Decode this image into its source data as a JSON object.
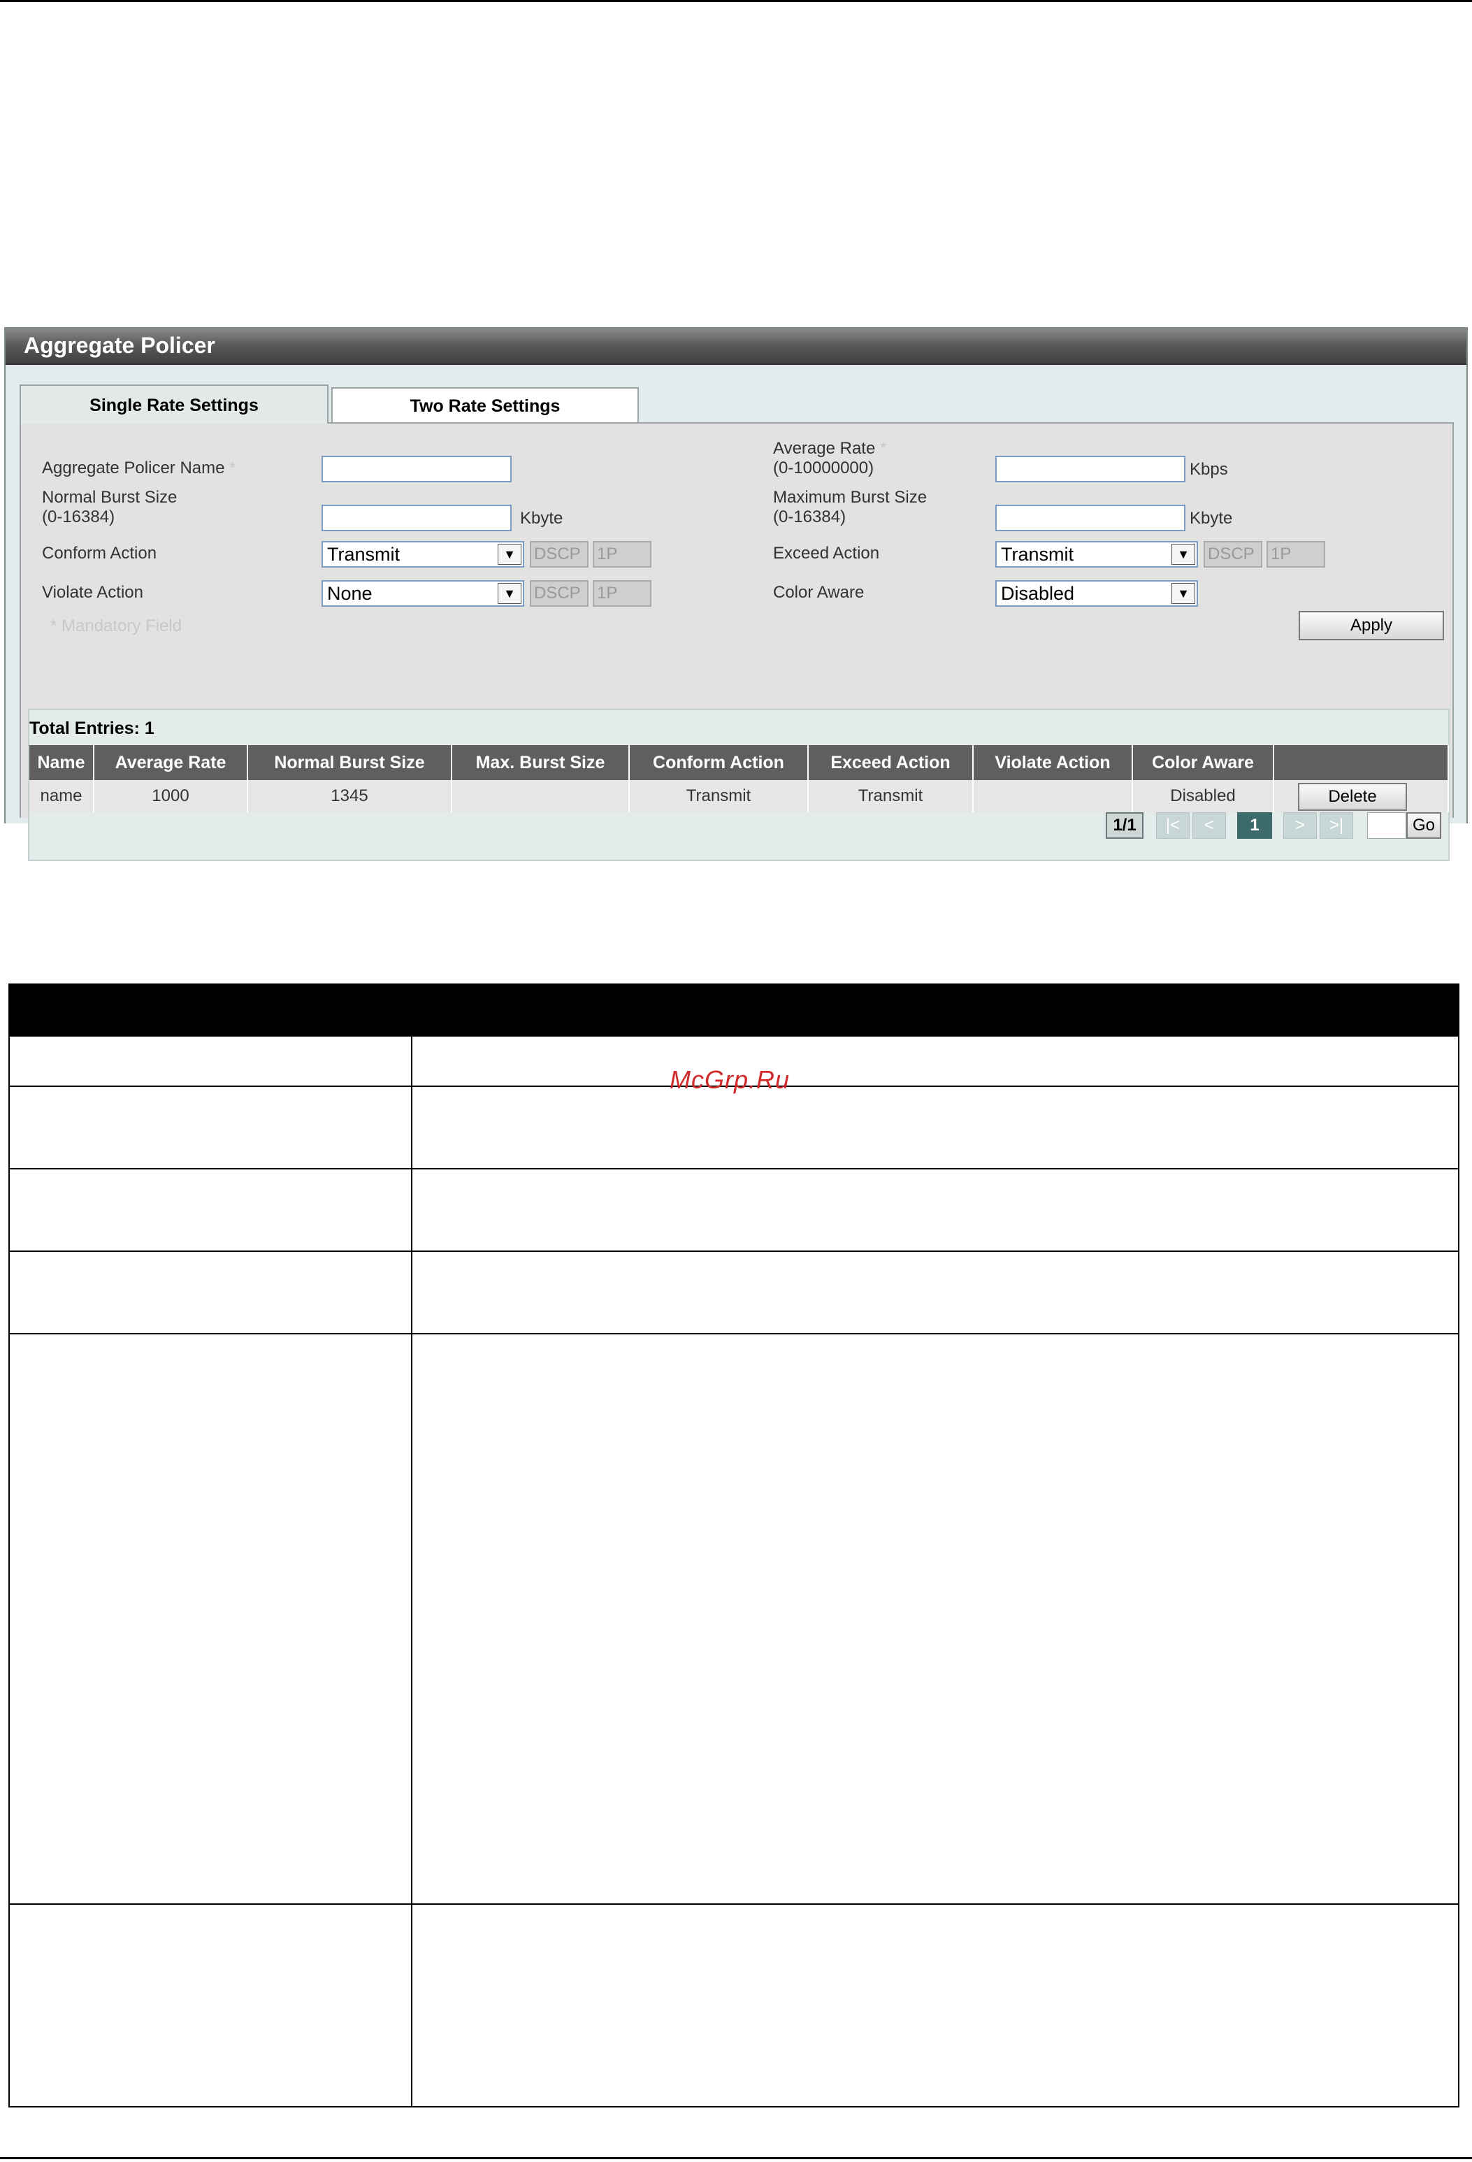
{
  "panel": {
    "title": "Aggregate Policer",
    "tabs": [
      {
        "label": "Single Rate Settings",
        "active": true
      },
      {
        "label": "Two Rate Settings",
        "active": false
      }
    ],
    "form": {
      "name_label": "Aggregate Policer Name",
      "required_mark": "*",
      "normal_burst_label_1": "Normal Burst Size",
      "normal_burst_label_2": "(0-16384)",
      "normal_burst_unit": "Kbyte",
      "conform_label": "Conform Action",
      "conform_value": "Transmit",
      "violate_label": "Violate Action",
      "violate_value": "None",
      "avg_rate_label_1": "Average Rate",
      "avg_rate_label_2": "(0-10000000)",
      "avg_rate_unit": "Kbps",
      "max_burst_label_1": "Maximum Burst Size",
      "max_burst_label_2": "(0-16384)",
      "max_burst_unit": "Kbyte",
      "exceed_label": "Exceed Action",
      "exceed_value": "Transmit",
      "color_aware_label": "Color Aware",
      "color_aware_value": "Disabled",
      "dscp_label": "DSCP",
      "onep_label": "1P",
      "mandatory_note": "* Mandatory Field",
      "apply_label": "Apply"
    },
    "entries": {
      "total_label": "Total Entries: 1",
      "columns": [
        "Name",
        "Average Rate",
        "Normal Burst Size",
        "Max. Burst Size",
        "Conform Action",
        "Exceed Action",
        "Violate Action",
        "Color Aware",
        ""
      ],
      "rows": [
        {
          "name": "name",
          "average_rate": "1000",
          "normal_burst": "1345",
          "max_burst": "",
          "conform": "Transmit",
          "exceed": "Transmit",
          "violate": "",
          "color_aware": "Disabled",
          "action": "Delete"
        }
      ]
    },
    "pagination": {
      "page_info": "1/1",
      "first": "|<",
      "prev": "<",
      "current": "1",
      "next": ">",
      "last": ">|",
      "go_label": "Go"
    }
  },
  "watermark": "McGrp.Ru",
  "colors": {
    "header_dark": "#3f3f3f",
    "panel_bg": "#e3ecec",
    "table_header": "#5f5f5f",
    "pager_active": "#3d6a6a",
    "watermark": "#d12a2a"
  }
}
